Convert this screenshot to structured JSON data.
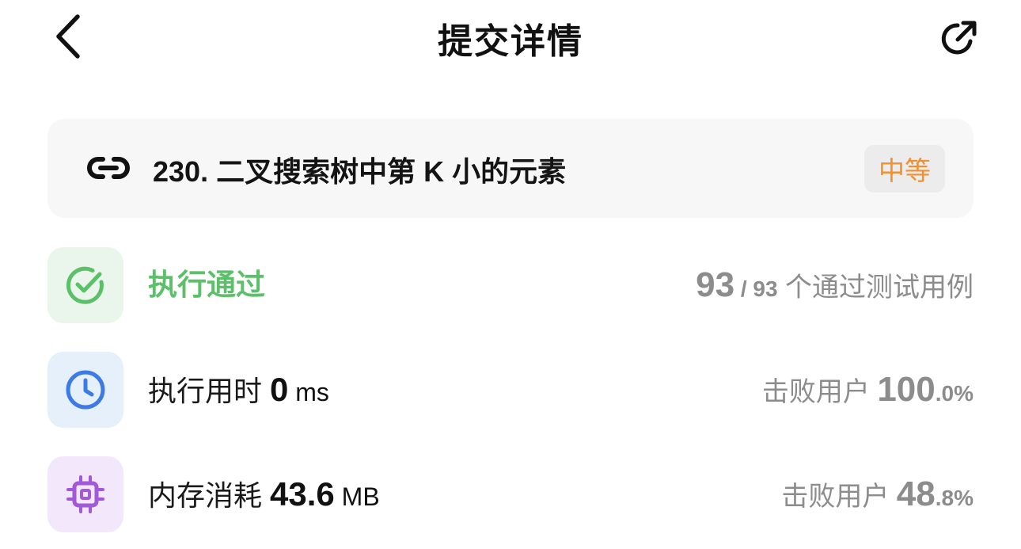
{
  "header": {
    "title": "提交详情",
    "back_icon": "chevron-left-icon",
    "share_icon": "share-icon"
  },
  "problem": {
    "title": "230. 二叉搜索树中第 K 小的元素",
    "difficulty": "中等",
    "difficulty_color": "#f2902f",
    "link_icon": "link-icon"
  },
  "result": {
    "status": "执行通过",
    "status_color": "#5cbf69",
    "passed": "93",
    "separator": " / ",
    "total": "93",
    "suffix": " 个通过测试用例"
  },
  "runtime": {
    "label": "执行用时 ",
    "value": "0",
    "unit": " ms",
    "beat_label": "击败用户 ",
    "beat_int": "100",
    "beat_dec": ".0%"
  },
  "memory": {
    "label": "内存消耗 ",
    "value": "43.6",
    "unit": " MB",
    "beat_label": "击败用户 ",
    "beat_int": "48",
    "beat_dec": ".8%"
  },
  "colors": {
    "pass_bg": "#eaf6ec",
    "clock_bg": "#e6f0fb",
    "clock_color": "#3c7be6",
    "chip_bg": "#f3e8fb",
    "chip_color": "#a259d9"
  }
}
